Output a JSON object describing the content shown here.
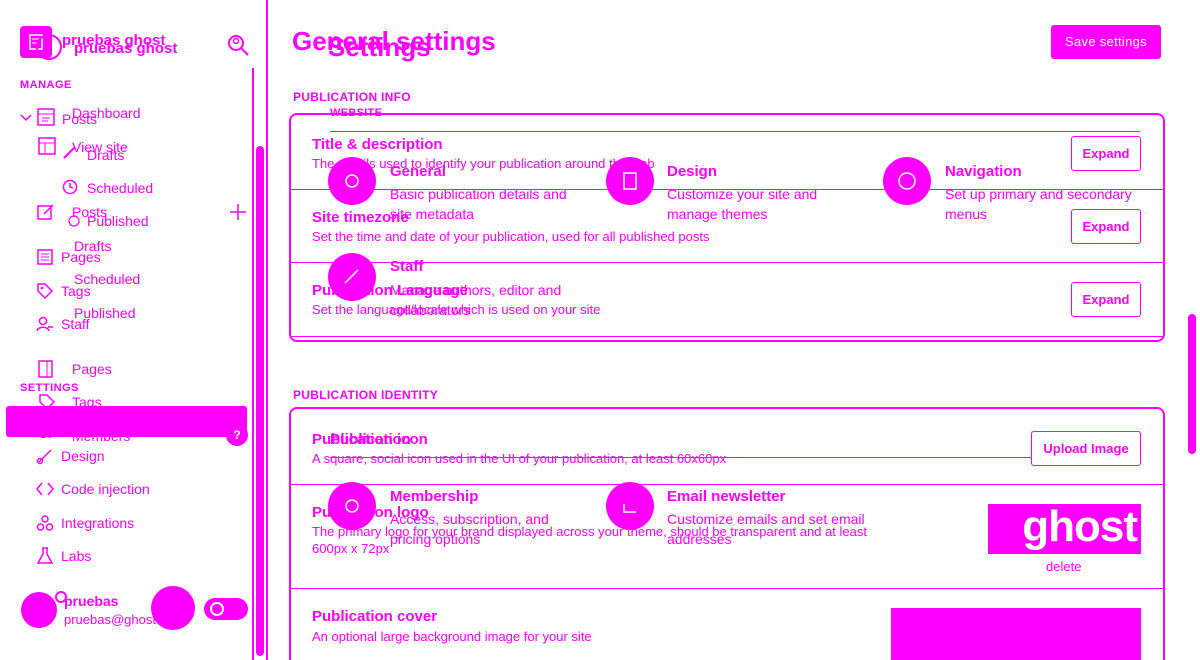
{
  "sidebar": {
    "site_name": "pruebas ghost",
    "site_name_overlay": "pruebas ghost",
    "manage_label": "MANAGE",
    "settings_label": "SETTINGS",
    "items": {
      "dashboard": "Dashboard",
      "view_site": "View site",
      "posts_a": "Posts",
      "drafts_a": "Drafts",
      "scheduled_a": "Scheduled",
      "published_a": "Published",
      "posts_b": "Posts",
      "drafts_b": "Drafts",
      "scheduled_b": "Scheduled",
      "published_b": "Published",
      "pages_a": "Pages",
      "tags_a": "Tags",
      "staff": "Staff",
      "pages_b": "Pages",
      "tags_b": "Tags",
      "members": "Members",
      "design": "Design",
      "code_injection": "Code injection",
      "integrations": "Integrations",
      "labs": "Labs"
    },
    "members_badge": "?",
    "user": {
      "name": "pruebas",
      "email": "pruebas@ghost"
    }
  },
  "main": {
    "title_a": "General settings",
    "title_b": "Settings",
    "save_button": "Save settings",
    "publication_info_label": "PUBLICATION INFO",
    "website_label": "WEBSITE",
    "publication_identity_label": "PUBLICATION IDENTITY",
    "rows": {
      "title_desc": {
        "title": "Title & description",
        "desc": "The details used to identify your publication around the web",
        "button": "Expand"
      },
      "timezone": {
        "title": "Site timezone",
        "desc": "Set the time and date of your publication, used for all published posts",
        "button": "Expand"
      },
      "language": {
        "title": "Publication Language",
        "desc": "Set the language/locale which is used on your site",
        "button": "Expand"
      },
      "icon": {
        "title": "Publication icon",
        "desc": "A square, social icon used in the UI of your publication, at least 60x60px",
        "button": "Upload Image"
      },
      "logo": {
        "title": "Publication logo",
        "desc_1": "The primary logo for your brand displayed across your theme, should be transparent and at least",
        "desc_2": "600px x 72px",
        "logo_text": "ghost",
        "delete": "delete"
      },
      "cover": {
        "title": "Publication cover",
        "desc": "An optional large background image for your site"
      }
    },
    "overlay_title": "Publication",
    "grid": [
      {
        "title": "General",
        "desc": "Basic publication details and site metadata",
        "icon": "gear-icon"
      },
      {
        "title": "Design",
        "desc": "Customize your site and manage themes",
        "icon": "design-icon"
      },
      {
        "title": "Navigation",
        "desc": "Set up primary and secondary menus",
        "icon": "compass-icon"
      },
      {
        "title": "Staff",
        "desc": "Manage authors, editor and collaborators",
        "icon": "staff-icon"
      },
      {
        "title": "Membership",
        "desc": "Access, subscription, and pricing options",
        "icon": "membership-icon"
      },
      {
        "title": "Email newsletter",
        "desc": "Customize emails and set email addresses",
        "icon": "email-icon"
      }
    ]
  },
  "colors": {
    "accent": "#ff00ff",
    "background": "#ffffff"
  }
}
